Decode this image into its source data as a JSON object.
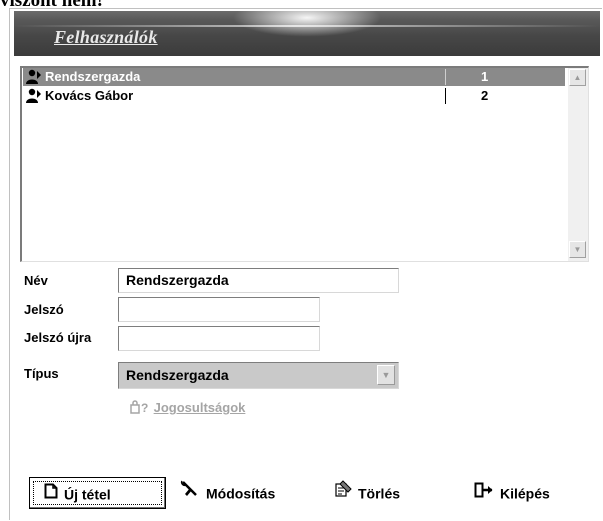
{
  "page_top_text": "viszont nem!",
  "window": {
    "title": "Felhasználók"
  },
  "users_list": {
    "rows": [
      {
        "name": "Rendszergazda",
        "id": "1",
        "selected": true
      },
      {
        "name": "Kovács Gábor",
        "id": "2",
        "selected": false
      }
    ]
  },
  "form": {
    "name_label": "Név",
    "name_value": "Rendszergazda",
    "password_label": "Jelszó",
    "password_value": "",
    "password_again_label": "Jelszó újra",
    "password_again_value": "",
    "type_label": "Típus",
    "type_value": "Rendszergazda",
    "permissions_label": "Jogosultságok"
  },
  "buttons": {
    "new_item": "Új tétel",
    "modify": "Módosítás",
    "delete": "Törlés",
    "exit": "Kilépés"
  },
  "icons": {
    "user": "user-icon",
    "key": "key-icon",
    "new": "new-document-icon",
    "modify": "tools-icon",
    "delete": "eraser-icon",
    "exit": "exit-door-icon"
  }
}
